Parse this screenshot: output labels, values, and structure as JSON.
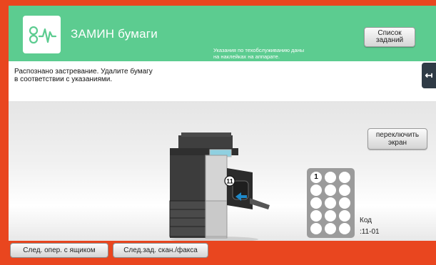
{
  "header": {
    "title": "ЗАМИН бумаги",
    "notice_line1": "Указания по техобслуживанию даны",
    "notice_line2": "на наклейках на аппарате.",
    "list_button_line1": "Список",
    "list_button_line2": "заданий",
    "logo_icon": "paper-jam-icon"
  },
  "message": {
    "line1": "Распознано застревание. Удалите бумагу",
    "line2": "в соответствии с указаниями."
  },
  "side_tab": {
    "icon": "arrow-left-icon",
    "glyph": "↤"
  },
  "illustration": {
    "jam_marker": "⑪",
    "switch_button_line1": "переключить",
    "switch_button_line2": "экран"
  },
  "keypad": {
    "keys": [
      "1",
      "",
      "",
      "",
      "",
      "",
      "",
      "",
      "",
      "",
      "",
      "",
      "",
      "",
      "",
      ""
    ],
    "highlighted_key": "1"
  },
  "code": {
    "label": "Код",
    "value": ":11-01"
  },
  "footer": {
    "button1": "След. опер. с ящиком",
    "button2": "След.зад. скан./факса"
  },
  "colors": {
    "frame": "#e9461f",
    "header": "#5ccc90",
    "printer_body": "#3c3c3c"
  }
}
